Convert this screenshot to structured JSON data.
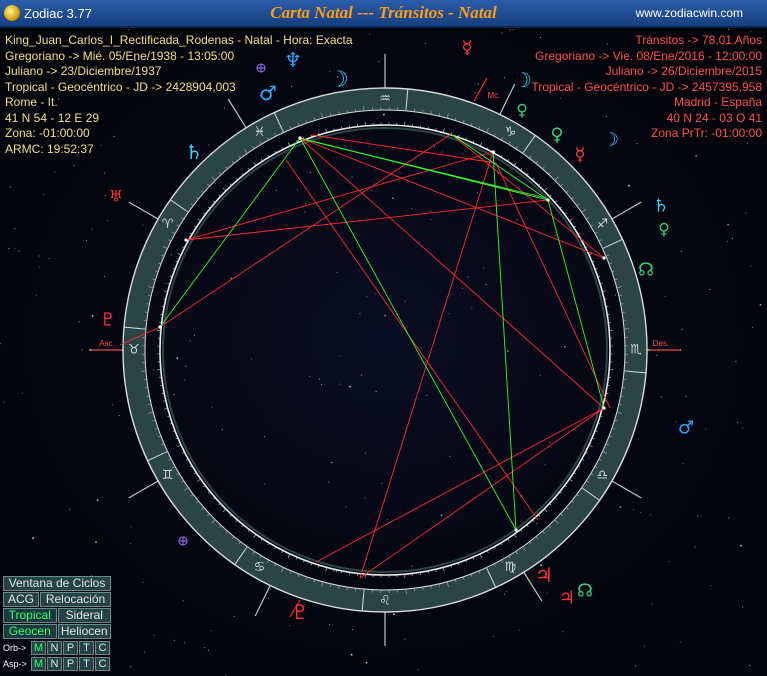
{
  "window": {
    "app_name": "Zodiac 3.77",
    "title": "Carta Natal --- Tránsitos - Natal",
    "website": "www.zodiacwin.com"
  },
  "natal": {
    "name": "King_Juan_Carlos_I_Rectificada_Rodenas - Natal - Hora: Exacta",
    "gregorian": "Gregoriano -> Mié. 05/Ene/1938 - 13:05:00",
    "julian": "Juliano -> 23/Diciembre/1937",
    "tropical": "Tropical - Geocéntrico - JD -> 2428904,003",
    "place": "Rome - It.",
    "coords": "41 N 54 - 12 E 29",
    "zone": "Zona: -01:00:00",
    "armc": "ARMC: 19:52:37"
  },
  "transits": {
    "header": "Tránsitos -> 78,01 Años",
    "gregorian": "Gregoriano -> Vie. 08/Ene/2016 - 12:00:00",
    "julian": "Juliano -> 26/Diciembre/2015",
    "tropical": "Tropical - Geocéntrico - JD -> 2457395,958",
    "place": "Madrid - España",
    "coords": "40 N 24 - 03 O 41",
    "zone": "Zona PrTr: -01:00:00"
  },
  "chart_labels": {
    "asc": "Asc.",
    "des": "Des.",
    "mc": "Mc."
  },
  "colors": {
    "natal_text": "#f0e27a",
    "transit_text": "#ff4d4d",
    "title": "#ff9b1a",
    "ring": "#2b4445",
    "aspect_red": "#ff2a2a",
    "aspect_green": "#2cff2c",
    "fire": "#ff3030",
    "air": "#2aa7ff",
    "water": "#2aa7ff",
    "earth": "#35d07a"
  },
  "zodiac_signs": [
    {
      "name": "aries",
      "glyph": "♈"
    },
    {
      "name": "taurus",
      "glyph": "♉"
    },
    {
      "name": "gemini",
      "glyph": "♊"
    },
    {
      "name": "cancer",
      "glyph": "♋"
    },
    {
      "name": "leo",
      "glyph": "♌"
    },
    {
      "name": "virgo",
      "glyph": "♍"
    },
    {
      "name": "libra",
      "glyph": "♎"
    },
    {
      "name": "scorpio",
      "glyph": "♏"
    },
    {
      "name": "sagittarius",
      "glyph": "♐"
    },
    {
      "name": "capricorn",
      "glyph": "♑"
    },
    {
      "name": "aquarius",
      "glyph": "♒"
    },
    {
      "name": "pisces",
      "glyph": "♓"
    }
  ],
  "outer_planets": [
    {
      "name": "mercury",
      "glyph": "☿",
      "color": "#ff3a3a"
    },
    {
      "name": "neptune",
      "glyph": "♆",
      "color": "#2aa7ff"
    },
    {
      "name": "moon",
      "glyph": "☽",
      "color": "#2ad7ff"
    },
    {
      "name": "saturn",
      "glyph": "♄",
      "color": "#2ad7ff"
    },
    {
      "name": "uranus",
      "glyph": "♅",
      "color": "#ff3030"
    },
    {
      "name": "pluto",
      "glyph": "♇",
      "color": "#ff3030"
    },
    {
      "name": "mars",
      "glyph": "♂",
      "color": "#2aa7ff"
    },
    {
      "name": "jupiter",
      "glyph": "♃",
      "color": "#ff3030"
    },
    {
      "name": "venus",
      "glyph": "♀",
      "color": "#35d07a"
    },
    {
      "name": "node",
      "glyph": "☊",
      "color": "#35d07a"
    }
  ],
  "menu": {
    "cycles": "Ventana de Ciclos",
    "acg": "ACG",
    "relocation": "Relocación",
    "tropical": "Tropical",
    "sidereal": "Sideral",
    "geocentric": "Geocen",
    "heliocentric": "Heliocen",
    "orb_label": "Orb->",
    "asp_label": "Asp->",
    "toggles": [
      "M",
      "N",
      "P",
      "T",
      "C"
    ]
  }
}
